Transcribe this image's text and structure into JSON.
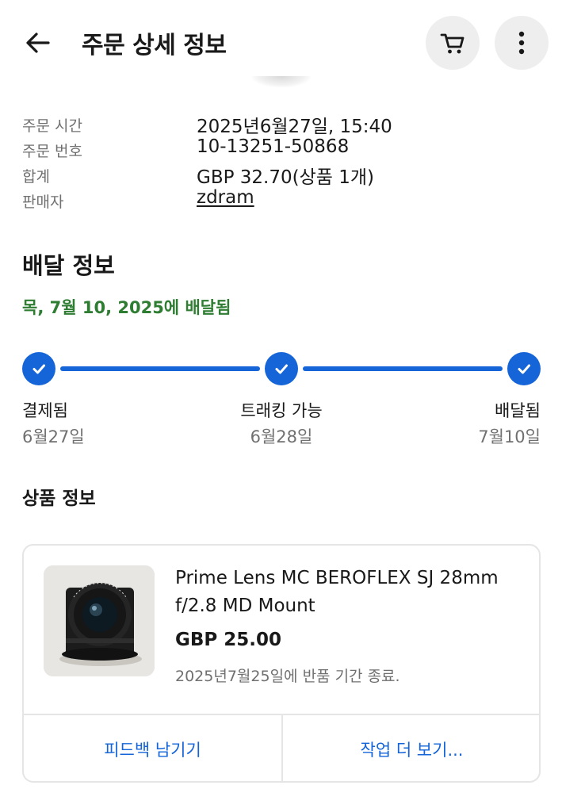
{
  "header": {
    "title": "주문 상세 정보",
    "back_icon": "arrow-left-icon",
    "cart_icon": "cart-icon",
    "more_icon": "more-vertical-icon"
  },
  "summary": {
    "rows": [
      {
        "label": "주문 시간",
        "value": "2025년6월27일, 15:40"
      },
      {
        "label": "주문 번호",
        "value": "10-13251-50868"
      },
      {
        "label": "합계",
        "value": "GBP 32.70(상품 1개)"
      },
      {
        "label": "판매자",
        "value": "zdram"
      }
    ]
  },
  "delivery": {
    "title": "배달 정보",
    "status": "목, 7월 10, 2025에 배달됨",
    "status_color": "#2e7d32",
    "accent_color": "#1565d8",
    "steps": [
      {
        "label": "결제됨",
        "date": "6월27일",
        "done": true
      },
      {
        "label": "트래킹 가능",
        "date": "6월28일",
        "done": true
      },
      {
        "label": "배달됨",
        "date": "7월10일",
        "done": true
      }
    ]
  },
  "product": {
    "section_title": "상품 정보",
    "name": "Prime Lens MC BEROFLEX SJ 28mm f/2.8 MD Mount",
    "price": "GBP 25.00",
    "return_note": "2025년7월25일에 반품 기간 종료.",
    "image_icon": "camera-lens-image",
    "actions": {
      "feedback": "피드백 남기기",
      "more": "작업 더 보기..."
    }
  }
}
